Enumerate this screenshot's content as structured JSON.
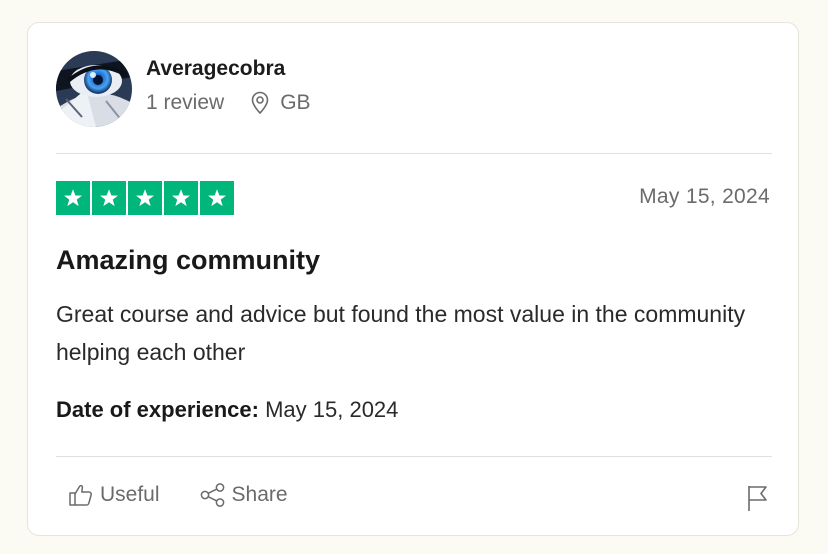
{
  "consumer": {
    "name": "Averagecobra",
    "reviews": "1 review",
    "country": "GB"
  },
  "review": {
    "rating": 5,
    "rating_color": "#00b67a",
    "date": "May 15, 2024",
    "title": "Amazing community",
    "body": "Great course and advice but found the most value in the community helping each other",
    "experience_label": "Date of experience:",
    "experience_date": "May 15, 2024"
  },
  "actions": {
    "useful_label": "Useful",
    "share_label": "Share",
    "report_icon": "flag-icon"
  }
}
